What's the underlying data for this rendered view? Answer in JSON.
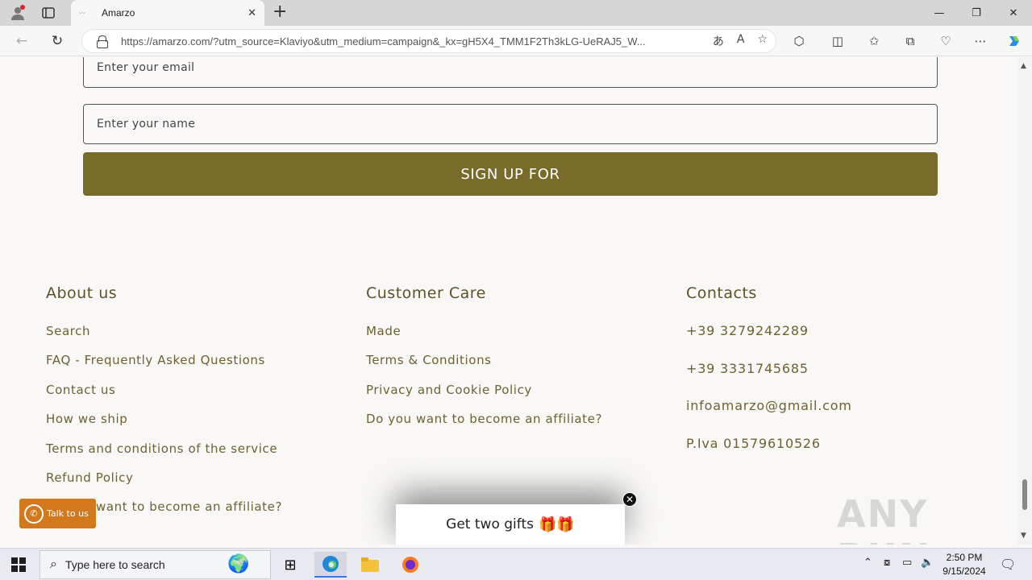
{
  "browser": {
    "tab_title": "Amarzo",
    "url": "https://amarzo.com/?utm_source=Klaviyo&utm_medium=campaign&_kx=gH5X4_TMM1F2Th3kLG-UeRAJ5_W..."
  },
  "form": {
    "email_placeholder": "Enter your email",
    "name_placeholder": "Enter your name",
    "signup_label": "SIGN UP FOR"
  },
  "footer": {
    "about": {
      "title": "About us",
      "links": [
        "Search",
        "FAQ - Frequently Asked Questions",
        "Contact us",
        "How we ship",
        "Terms and conditions of the service",
        "Refund Policy",
        "Do you want to become an affiliate?"
      ]
    },
    "care": {
      "title": "Customer Care",
      "links": [
        "Made",
        "Terms & Conditions",
        "Privacy and Cookie Policy",
        "Do you want to become an affiliate?"
      ]
    },
    "contacts": {
      "title": "Contacts",
      "items": [
        "+39 3279242289",
        "+39 3331745685",
        "infoamarzo@gmail.com",
        "P.Iva 01579610526"
      ]
    }
  },
  "widgets": {
    "talk_label": "Talk to us",
    "gifts_label": "Get two gifts",
    "gift_icon": "🎁🎁",
    "watermark": "ANY RUN"
  },
  "taskbar": {
    "search_placeholder": "Type here to search",
    "time": "2:50 PM",
    "date": "9/15/2024"
  },
  "colors": {
    "accent": "#786a28",
    "talk_button": "#d1791c"
  }
}
